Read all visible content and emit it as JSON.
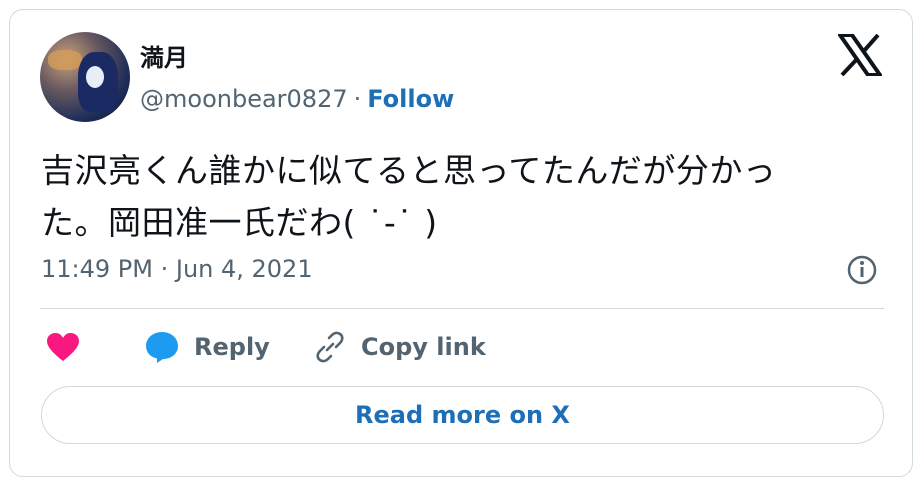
{
  "author": {
    "name": "満月",
    "handle": "@moonbear0827",
    "separator": "·",
    "follow_label": "Follow"
  },
  "tweet": {
    "line1": "吉沢亮くん誰かに似てると思ってたんだが分かっ",
    "line2": "た。岡田准一氏だわ( ˙-˙ )",
    "timestamp": "11:49 PM · Jun 4, 2021"
  },
  "actions": {
    "reply_label": "Reply",
    "copy_label": "Copy link"
  },
  "read_more_label": "Read more on X",
  "colors": {
    "heart": "#f91880",
    "reply_bubble": "#1d9bf0",
    "link": "#1d6fb8",
    "muted": "#536471"
  },
  "icons": [
    "x-logo-icon",
    "info-icon",
    "heart-icon",
    "reply-bubble-icon",
    "link-icon"
  ]
}
